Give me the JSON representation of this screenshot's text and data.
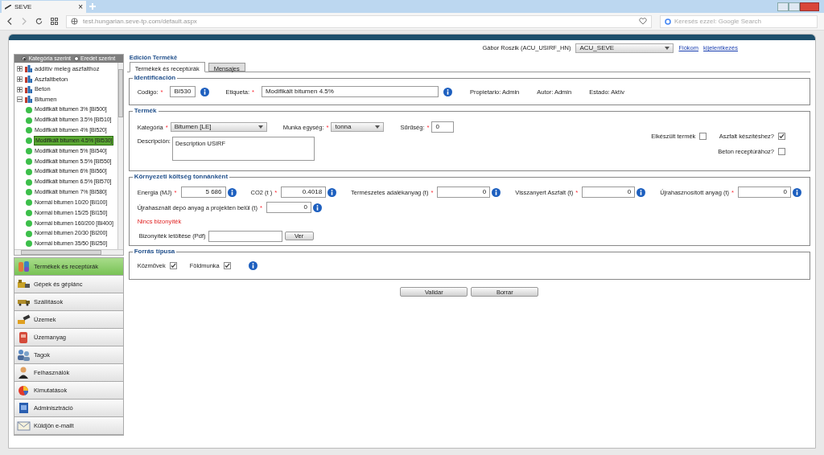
{
  "browser": {
    "tab": {
      "title": "SEVE",
      "close": "×"
    },
    "url": "test.hungarian.seve-tp.com/default.aspx",
    "search": {
      "placeholder": "Keresés ezzel: Google Search"
    }
  },
  "user": {
    "name": "Gábor Roszik (ACU_USIRF_HN)",
    "account": "ACU_SEVE",
    "links": [
      "Fiókom",
      "kijelentkezés"
    ]
  },
  "tree": {
    "modes": [
      {
        "label": "Kategória szerint",
        "selected": true
      },
      {
        "label": "Eredet szerint",
        "selected": false
      }
    ],
    "items": [
      {
        "label": "additív meleg aszfalthoz",
        "expanded": false
      },
      {
        "label": "Aszfaltbeton",
        "expanded": false
      },
      {
        "label": "Beton",
        "expanded": false
      },
      {
        "label": "Bitumen",
        "expanded": true,
        "children": [
          {
            "label": "Modifikált bitumen 3% [BI500]",
            "selected": false
          },
          {
            "label": "Modifikált bitumen 3.5% [BI510]",
            "selected": false
          },
          {
            "label": "Modifikált bitumen 4% [BI520]",
            "selected": false
          },
          {
            "label": "Modifikált bitumen 4.5% [BI530]",
            "selected": true
          },
          {
            "label": "Modifikált bitumen 5% [BI540]",
            "selected": false
          },
          {
            "label": "Modifikált bitumen 5.5% [BI550]",
            "selected": false
          },
          {
            "label": "Modifikált bitumen 6% [BI560]",
            "selected": false
          },
          {
            "label": "Modifikált bitumen 6.5% [BI570]",
            "selected": false
          },
          {
            "label": "Modifikált bitumen 7% [BI580]",
            "selected": false
          },
          {
            "label": "Normál bitumen 10/20 [BI100]",
            "selected": false
          },
          {
            "label": "Normál bitumen 15/25 [BI150]",
            "selected": false
          },
          {
            "label": "Normál bitumen 160/200 [BI400]",
            "selected": false
          },
          {
            "label": "Normál bitumen 20/30 [BI200]",
            "selected": false
          },
          {
            "label": "Normál bitumen 35/50 [BI250]",
            "selected": false
          }
        ]
      }
    ]
  },
  "menu": [
    {
      "label": "Termékek és receptúrák",
      "selected": true,
      "kind": "flask"
    },
    {
      "label": "Gépek és géplánc",
      "selected": false,
      "kind": "machine"
    },
    {
      "label": "Szállítások",
      "selected": false,
      "kind": "truck"
    },
    {
      "label": "Üzemek",
      "selected": false,
      "kind": "plant"
    },
    {
      "label": "Üzemanyag",
      "selected": false,
      "kind": "fuel"
    },
    {
      "label": "Tagok",
      "selected": false,
      "kind": "members"
    },
    {
      "label": "Felhasználók",
      "selected": false,
      "kind": "user"
    },
    {
      "label": "Kimutatások",
      "selected": false,
      "kind": "chart"
    },
    {
      "label": "Adminisztráció",
      "selected": false,
      "kind": "admin"
    },
    {
      "label": "Küldjön e-mailt",
      "selected": false,
      "kind": "mail"
    }
  ],
  "page_title": "Edición Termékě",
  "tabs": [
    {
      "label": "Termékek és receptúrák",
      "selected": true
    },
    {
      "label": "Mensajes",
      "selected": false
    }
  ],
  "identification": {
    "legend": "Identificación",
    "codigo": {
      "label": "Codigo:",
      "mark": "*",
      "value": "BI530"
    },
    "etiqueta": {
      "label": "Etiqueta:",
      "mark": "*",
      "value": "Modifikált bitumen 4.5%"
    },
    "info": [
      "Propietario: Admin",
      "Autor: Admin",
      "Estado: Aktív"
    ]
  },
  "product": {
    "legend": "Termék",
    "kategoria": {
      "label": "Kategória",
      "mark": "*",
      "value": "Bitumen [LE]"
    },
    "unit": {
      "label": "Munka egység:",
      "mark": "*",
      "value": "tonna"
    },
    "density": {
      "label": "Sűrűség:",
      "mark": "*",
      "value": "0"
    },
    "description": {
      "label": "Descripción:",
      "value": "Description USIRF"
    },
    "checks": [
      {
        "label": "Elkészült termék",
        "checked": false
      },
      {
        "label": "Aszfalt készítéshez?",
        "checked": true
      },
      {
        "label": "Beton receptúrához?",
        "checked": false
      }
    ]
  },
  "environment": {
    "legend": "Környezeti költség tonnánként",
    "fields": [
      {
        "label": "Energia (MJ)",
        "mark": "*",
        "value": "5 686"
      },
      {
        "label": "CO2 (t )",
        "mark": "*",
        "value": "0.4018"
      },
      {
        "label": "Természetes adalékanyag (t)",
        "mark": "*",
        "value": "0"
      },
      {
        "label": "Visszanyert Aszfalt (t)",
        "mark": "*",
        "value": "0"
      },
      {
        "label": "Újrahasznosított anyag (t)",
        "mark": "*",
        "value": "0"
      }
    ],
    "depot": {
      "label": "Újrahasznált depó anyag a projekten belül (t)",
      "mark": "*",
      "value": "0"
    },
    "warning": "Nincs bizonyíték",
    "upload": {
      "label": "Bizonyíték letöltése (Pdf)",
      "button": "Ver"
    }
  },
  "source": {
    "legend": "Forrás típusa",
    "checks": [
      {
        "label": "Közművek",
        "checked": true
      },
      {
        "label": "Földmunka",
        "checked": true
      }
    ]
  },
  "buttons": [
    "Validar",
    "Borrar"
  ]
}
